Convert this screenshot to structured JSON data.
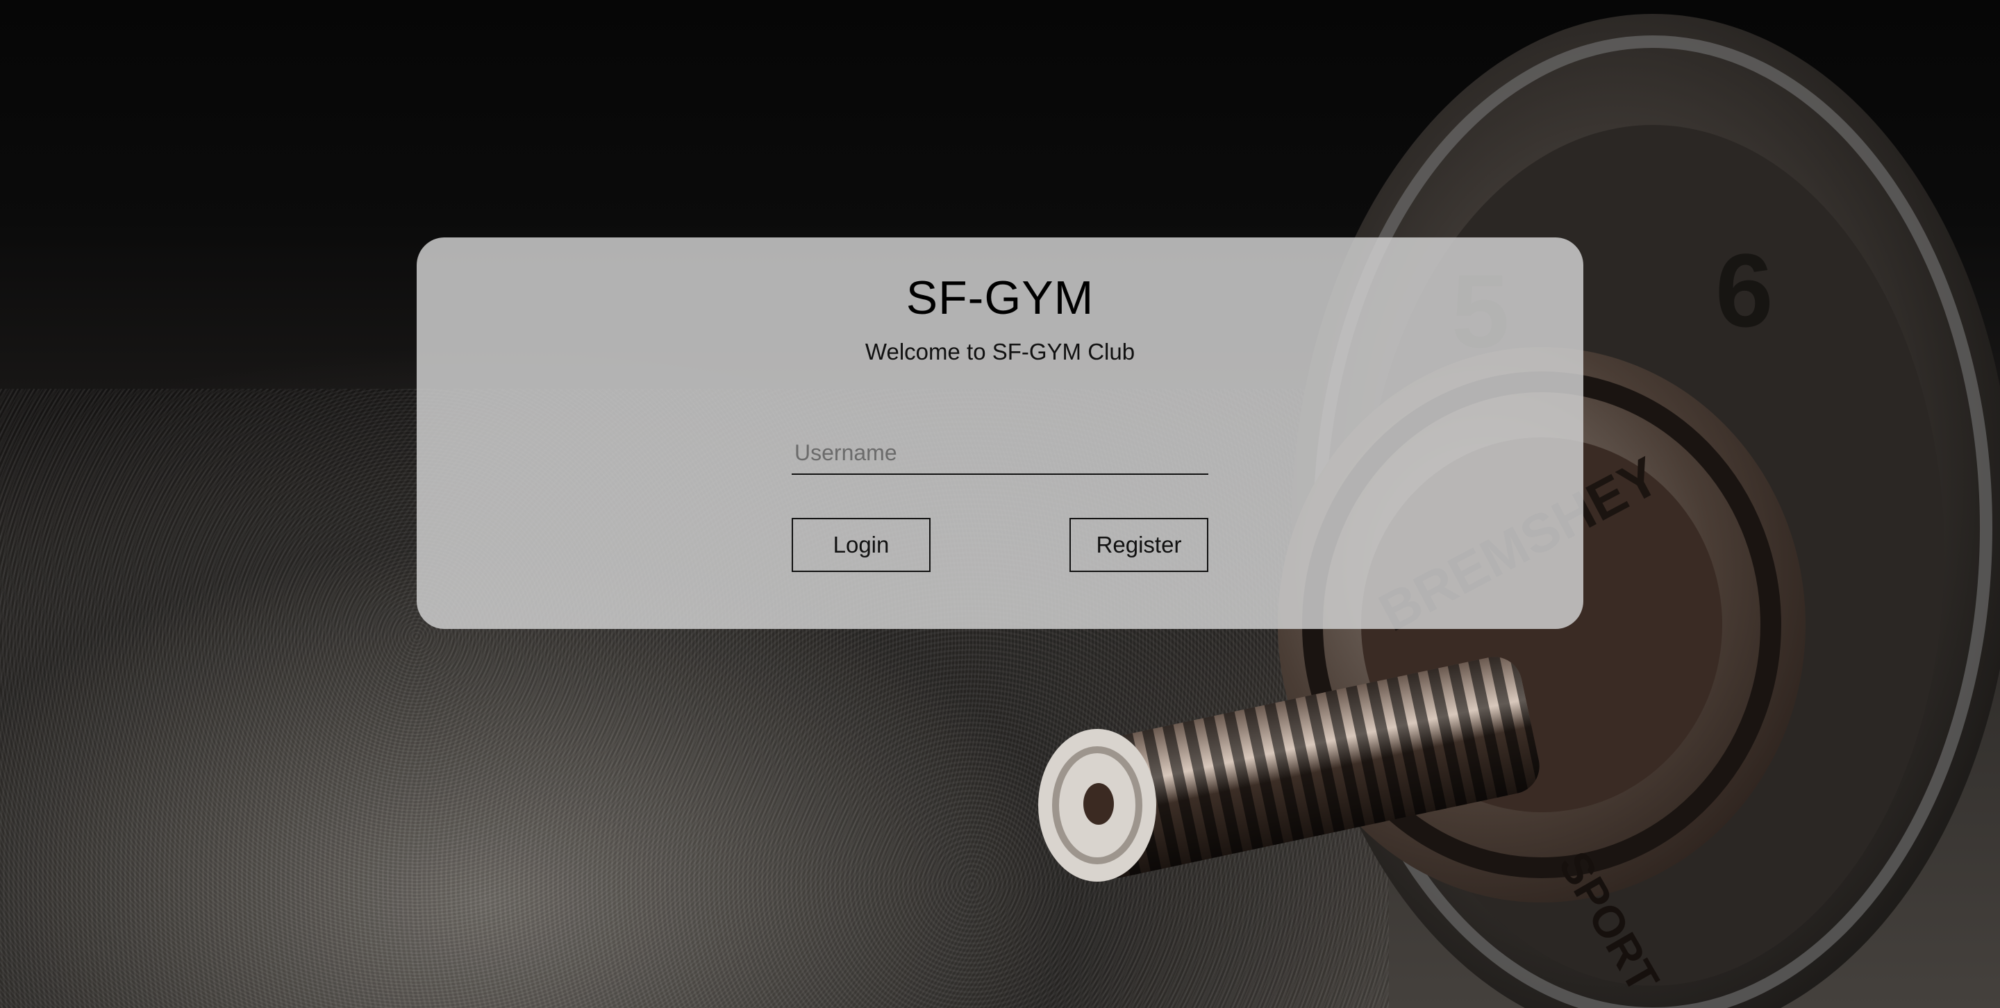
{
  "login": {
    "title": "SF-GYM",
    "subtitle": "Welcome to SF-GYM Club",
    "username_placeholder": "Username",
    "username_value": "",
    "login_label": "Login",
    "register_label": "Register"
  },
  "background": {
    "description_icon": "dumbbell-icon",
    "plate_inner_text": "BREMSHEY",
    "plate_outer_text": "5",
    "plate_rim_text": "SPORT"
  },
  "colors": {
    "card": "#cdcdcd",
    "text": "#000000",
    "border": "#111111"
  }
}
